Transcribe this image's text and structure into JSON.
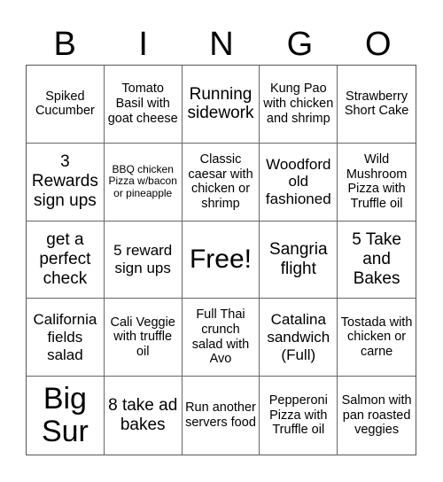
{
  "header": {
    "letters": [
      "B",
      "I",
      "N",
      "G",
      "O"
    ]
  },
  "board": {
    "cells": [
      "Spiked Cucumber",
      "Tomato Basil with goat cheese",
      "Running sidework",
      "Kung Pao with chicken and shrimp",
      "Strawberry Short Cake",
      "3 Rewards sign ups",
      "BBQ chicken Pizza w/bacon or pineapple",
      "Classic caesar with chicken or shrimp",
      "Woodford old fashioned",
      "Wild Mushroom Pizza with Truffle oil",
      "get a perfect check",
      "5 reward sign ups",
      "Free!",
      "Sangria flight",
      "5 Take and Bakes",
      "California fields salad",
      "Cali Veggie with truffle oil",
      "Full Thai crunch salad with Avo",
      "Catalina sandwich (Full)",
      "Tostada with chicken or carne",
      "Big Sur",
      "8 take ad bakes",
      "Run another servers food",
      "Pepperoni Pizza with Truffle oil",
      "Salmon with pan roasted veggies"
    ]
  }
}
